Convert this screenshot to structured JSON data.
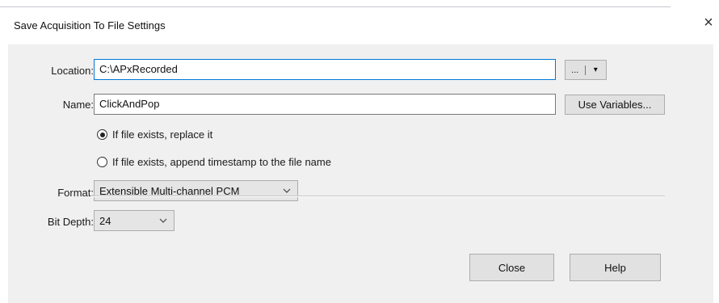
{
  "dialog": {
    "title": "Save Acquisition To File Settings",
    "close_glyph": "×"
  },
  "location": {
    "label": "Location:",
    "value": "C:\\APxRecorded",
    "browse_label": "...",
    "dropdown_glyph": "▾"
  },
  "name": {
    "label": "Name:",
    "value": "ClickAndPop",
    "variables_button": "Use Variables..."
  },
  "options": {
    "replace": {
      "label": "If file exists, replace it",
      "selected": true
    },
    "append": {
      "label": "If file exists, append timestamp to the file name",
      "selected": false
    }
  },
  "format": {
    "label": "Format:",
    "selected": "Extensible Multi-channel PCM"
  },
  "bit_depth": {
    "label": "Bit Depth:",
    "selected": "24"
  },
  "footer": {
    "close_button": "Close",
    "help_button": "Help"
  },
  "colors": {
    "panel_bg": "#f0f0f0",
    "focus_border": "#0078d7",
    "button_bg": "#e1e1e1"
  }
}
